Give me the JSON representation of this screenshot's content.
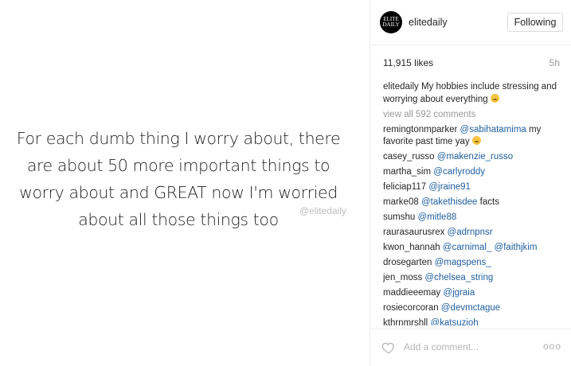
{
  "post": {
    "quote_lines": [
      "For each dumb thing I worry about, there",
      "are about 50 more important things to",
      "worry about and GREAT now I'm worried",
      "about all those things too"
    ],
    "watermark": "@elitedaily"
  },
  "header": {
    "avatar_text": [
      "ELITE",
      "DAILY"
    ],
    "username": "elitedaily",
    "follow_label": "Following"
  },
  "meta": {
    "likes": "11,915 likes",
    "time": "5h"
  },
  "caption": {
    "author": "elitedaily",
    "text": "My hobbies include stressing and worrying about everything",
    "emoji": "grimacing-face"
  },
  "view_all": "view all 592 comments",
  "comments": [
    {
      "author": "remingtonmparker",
      "mention": "@sabihatamima",
      "text": "my favorite past time yay",
      "emoji": "grimacing-face"
    },
    {
      "author": "casey_russo",
      "mention": "@makenzie_russo",
      "text": ""
    },
    {
      "author": "martha_sim",
      "mention": "@carlyroddy",
      "text": ""
    },
    {
      "author": "feliciap117",
      "mention": "@jraine91",
      "text": ""
    },
    {
      "author": "marke08",
      "mention": "@takethisdee",
      "text": "facts"
    },
    {
      "author": "sumshu",
      "mention": "@mitle88",
      "text": ""
    },
    {
      "author": "raurasaurusrex",
      "mention": "@adrnpnsr",
      "text": ""
    },
    {
      "author": "kwon_hannah",
      "mention": "@carnimal_ @faithjkim",
      "text": ""
    },
    {
      "author": "drosegarten",
      "mention": "@magspens_",
      "text": ""
    },
    {
      "author": "jen_moss",
      "mention": "@chelsea_string",
      "text": ""
    },
    {
      "author": "maddieeemay",
      "mention": "@jgraia",
      "text": ""
    },
    {
      "author": "rosiecorcoran",
      "mention": "@devmctague",
      "text": ""
    },
    {
      "author": "kthrnmrshll",
      "mention": "@katsuzioh",
      "text": ""
    }
  ],
  "footer": {
    "add_comment_placeholder": "Add a comment...",
    "more_label": "ooo",
    "heart_icon": "heart-outline-icon"
  },
  "colors": {
    "mention": "#1f5fa0",
    "muted": "#999999",
    "text": "#262626"
  }
}
